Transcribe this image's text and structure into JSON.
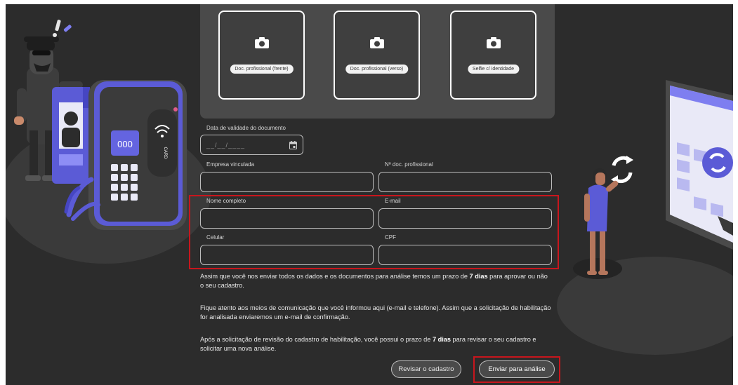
{
  "uploads": [
    {
      "label": "Doc. profissional (frente)",
      "icon": "camera-icon"
    },
    {
      "label": "Doc. profissional (verso)",
      "icon": "camera-icon"
    },
    {
      "label": "Selfie c/ identidade",
      "icon": "camera-icon"
    }
  ],
  "form": {
    "validity_label": "Data de validade do documento",
    "validity_placeholder": "__/__/____",
    "company_label": "Empresa vinculada",
    "doc_number_label": "Nº doc. profissional",
    "name_label": "Nome completo",
    "email_label": "E-mail",
    "phone_label": "Celular",
    "cpf_label": "CPF"
  },
  "info": {
    "p1_before": "Assim que você nos enviar todos os dados e os documentos para análise temos um prazo de ",
    "p1_bold": "7 dias",
    "p1_after": " para aprovar ou não o seu cadastro.",
    "p2": "Fique atento aos meios de comunicação que você informou aqui (e-mail e telefone). Assim que a solicitação de habilitação for analisada enviaremos um e-mail de confirmação.",
    "p3_before": "Após a solicitação de revisão do cadastro de habilitação, você possui o prazo de ",
    "p3_bold": "7 dias",
    "p3_after": " para revisar o seu cadastro e solicitar uma nova análise."
  },
  "actions": {
    "review_label": "Revisar o cadastro",
    "submit_label": "Enviar para análise"
  },
  "illustration": {
    "card_number": "000",
    "card_text": "CARD"
  },
  "colors": {
    "background": "#2c2c2c",
    "panel": "#4a4a4a",
    "highlight": "#c8161d",
    "accent_purple": "#5b5bd6"
  }
}
